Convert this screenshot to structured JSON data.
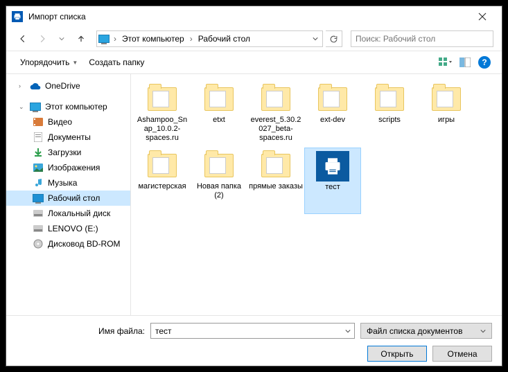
{
  "title": "Импорт списка",
  "nav": {
    "root": "Этот компьютер",
    "location": "Рабочий стол",
    "search_placeholder": "Поиск: Рабочий стол"
  },
  "toolbar": {
    "organize": "Упорядочить",
    "new_folder": "Создать папку"
  },
  "tree": {
    "onedrive": "OneDrive",
    "this_pc": "Этот компьютер",
    "videos": "Видео",
    "documents": "Документы",
    "downloads": "Загрузки",
    "pictures": "Изображения",
    "music": "Музыка",
    "desktop": "Рабочий стол",
    "local_disk": "Локальный диск",
    "lenovo": "LENOVO (E:)",
    "bd": "Дисковод BD-ROM"
  },
  "items": [
    {
      "label": "Ashampoo_Snap_10.0.2-spaces.ru",
      "type": "folder"
    },
    {
      "label": "etxt",
      "type": "folder"
    },
    {
      "label": "everest_5.30.2027_beta-spaces.ru",
      "type": "folder"
    },
    {
      "label": "ext-dev",
      "type": "folder"
    },
    {
      "label": "scripts",
      "type": "folder"
    },
    {
      "label": "игры",
      "type": "folder"
    },
    {
      "label": "магистерская",
      "type": "folder"
    },
    {
      "label": "Новая папка (2)",
      "type": "folder"
    },
    {
      "label": "прямые заказы",
      "type": "folder"
    },
    {
      "label": "тест",
      "type": "printer",
      "selected": true
    }
  ],
  "footer": {
    "filename_label": "Имя файла:",
    "filename_value": "тест",
    "filter": "Файл списка документов",
    "open": "Открыть",
    "cancel": "Отмена"
  }
}
